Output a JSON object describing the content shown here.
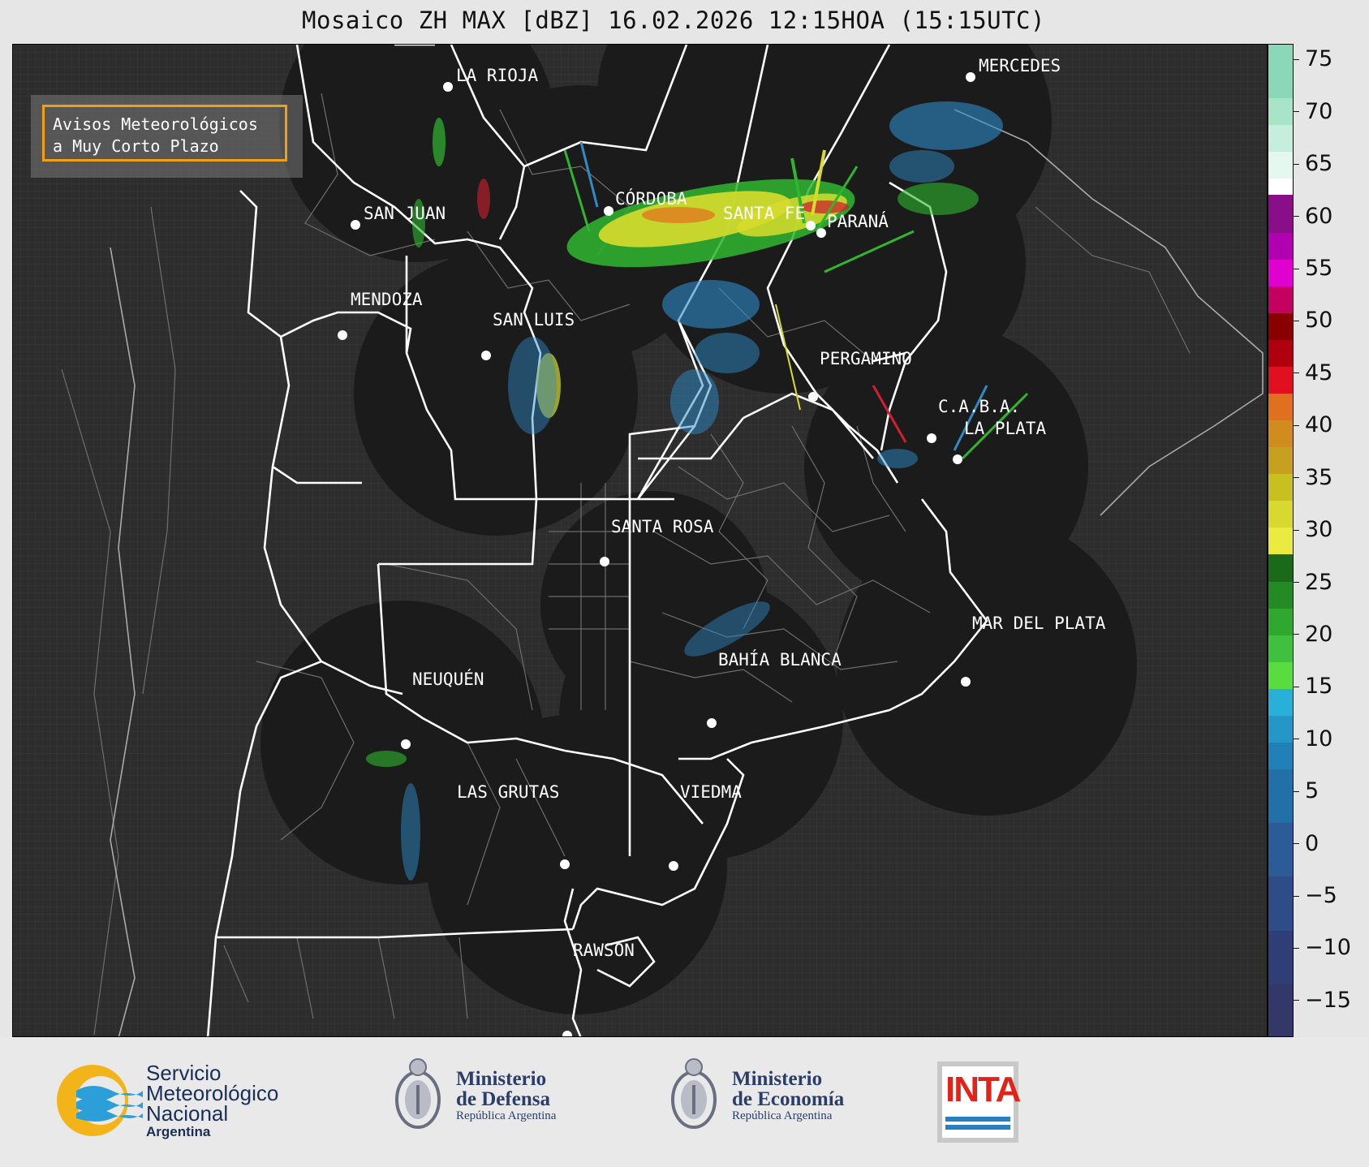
{
  "title": "Mosaico ZH MAX [dBZ] 16.02.2026 12:15HOA (15:15UTC)",
  "notice": {
    "line1": "Avisos Meteorológicos",
    "line2": "a Muy Corto Plazo",
    "border_color": "#f0a010"
  },
  "cities": [
    {
      "name": "LA RIOJA"
    },
    {
      "name": "MERCEDES"
    },
    {
      "name": "SAN JUAN"
    },
    {
      "name": "CÓRDOBA"
    },
    {
      "name": "SANTA FE"
    },
    {
      "name": "PARANÁ"
    },
    {
      "name": "MENDOZA"
    },
    {
      "name": "SAN LUIS"
    },
    {
      "name": "PERGAMINO"
    },
    {
      "name": "C.A.B.A."
    },
    {
      "name": "LA PLATA"
    },
    {
      "name": "SANTA ROSA"
    },
    {
      "name": "MAR DEL PLATA"
    },
    {
      "name": "BAHÍA BLANCA"
    },
    {
      "name": "NEUQUÉN"
    },
    {
      "name": "LAS GRUTAS"
    },
    {
      "name": "VIEDMA"
    },
    {
      "name": "RAWSON"
    }
  ],
  "colorbar": {
    "unit": "dBZ",
    "ticks": [
      "75",
      "70",
      "65",
      "60",
      "55",
      "50",
      "45",
      "40",
      "35",
      "30",
      "25",
      "20",
      "15",
      "10",
      "5",
      "0",
      "−5",
      "−10",
      "−15"
    ],
    "range": [
      -18.5,
      76.5
    ]
  },
  "footer": {
    "smn": {
      "line1": "Servicio",
      "line2": "Meteorológico",
      "line3": "Nacional",
      "sub": "Argentina"
    },
    "defensa": {
      "line1": "Ministerio",
      "line2": "de Defensa",
      "sub": "República Argentina"
    },
    "economia": {
      "line1": "Ministerio",
      "line2": "de Economía",
      "sub": "República Argentina"
    },
    "inta": {
      "label": "INTA"
    }
  },
  "colors": {
    "background": "#2d2d2d",
    "radar_cover": "#1b1b1b",
    "province_border": "#ffffff",
    "dept_border": "#777777"
  }
}
